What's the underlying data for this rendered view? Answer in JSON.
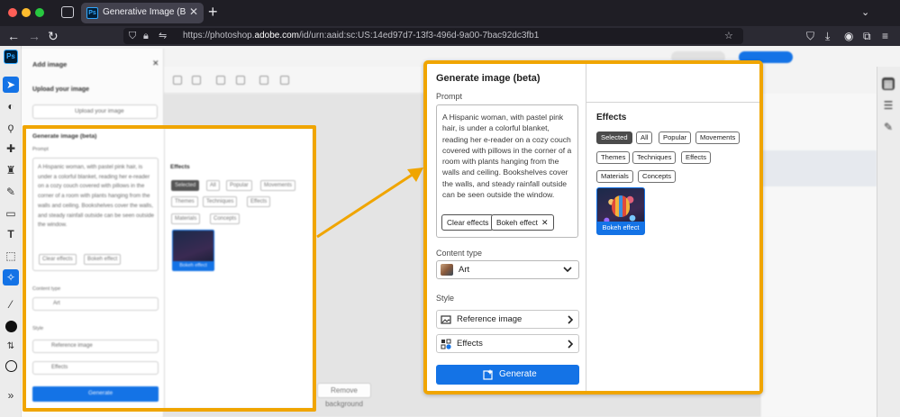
{
  "browser": {
    "tab_title": "Generative Image (Beta) - Adobe",
    "tab_favicon": "Ps",
    "url_prefix": "https://photoshop.",
    "url_domain": "adobe.com",
    "url_suffix": "/id/urn:aaid:sc:US:14ed97d7-13f3-496d-9a00-7bac92dc3fb1",
    "icons": [
      "back-icon",
      "forward-icon",
      "reload-icon",
      "shield-icon",
      "lock-icon",
      "bookmark-star-icon",
      "pocket-icon",
      "download-icon",
      "account-icon",
      "extensions-icon",
      "menu-icon"
    ]
  },
  "app": {
    "logo": "Ps",
    "faded_dialog": {
      "add_image_title": "Add image",
      "upload_title": "Upload your image",
      "upload_button": "Upload your image",
      "section_title": "Generate image (beta)",
      "prompt_label": "Prompt",
      "prompt_text": "A Hispanic woman, with pastel pink hair, is under a colorful blanket, reading her e-reader on a cozy couch covered with pillows in the corner of a room with plants hanging from the walls and ceiling. Bookshelves cover the walls, and steady rainfall outside can be seen outside the window.",
      "clear_effects": "Clear effects",
      "bokeh_chip": "Bokeh effect",
      "content_type_label": "Content type",
      "content_type_value": "Art",
      "style_label": "Style",
      "reference_image": "Reference image",
      "effects": "Effects",
      "generate": "Generate",
      "effects_title": "Effects",
      "effect_filters": [
        "Selected",
        "All",
        "Popular",
        "Movements",
        "Themes",
        "Techniques",
        "Effects",
        "Materials",
        "Concepts"
      ],
      "tile_label": "Bokeh effect"
    },
    "bottom_pill": "Remove background"
  },
  "dialog": {
    "title": "Generate image (beta)",
    "prompt_label": "Prompt",
    "prompt_text": "A Hispanic woman, with pastel pink hair, is under a colorful blanket, reading her e-reader on a cozy couch covered with pillows in the corner of a room with plants hanging from the walls and ceiling. Bookshelves cover the walls, and steady rainfall outside can be seen outside the window.",
    "chips": {
      "clear_effects": "Clear effects",
      "bokeh_effect": "Bokeh effect",
      "remove_symbol": "✕"
    },
    "content_type": {
      "label": "Content type",
      "value": "Art"
    },
    "style": {
      "label": "Style",
      "reference_image": "Reference image",
      "effects": "Effects"
    },
    "generate_button": "Generate",
    "effects_panel": {
      "title": "Effects",
      "filters": {
        "selected": "Selected",
        "all": "All",
        "popular": "Popular",
        "movements": "Movements",
        "themes": "Themes",
        "techniques": "Techniques",
        "effects": "Effects",
        "materials": "Materials",
        "concepts": "Concepts"
      },
      "selected_filter": "Selected",
      "tile_label": "Bokeh effect"
    }
  },
  "colors": {
    "accent_blue": "#1473e6",
    "highlight_orange": "#f0a500",
    "chrome_dark": "#1f1e25"
  }
}
